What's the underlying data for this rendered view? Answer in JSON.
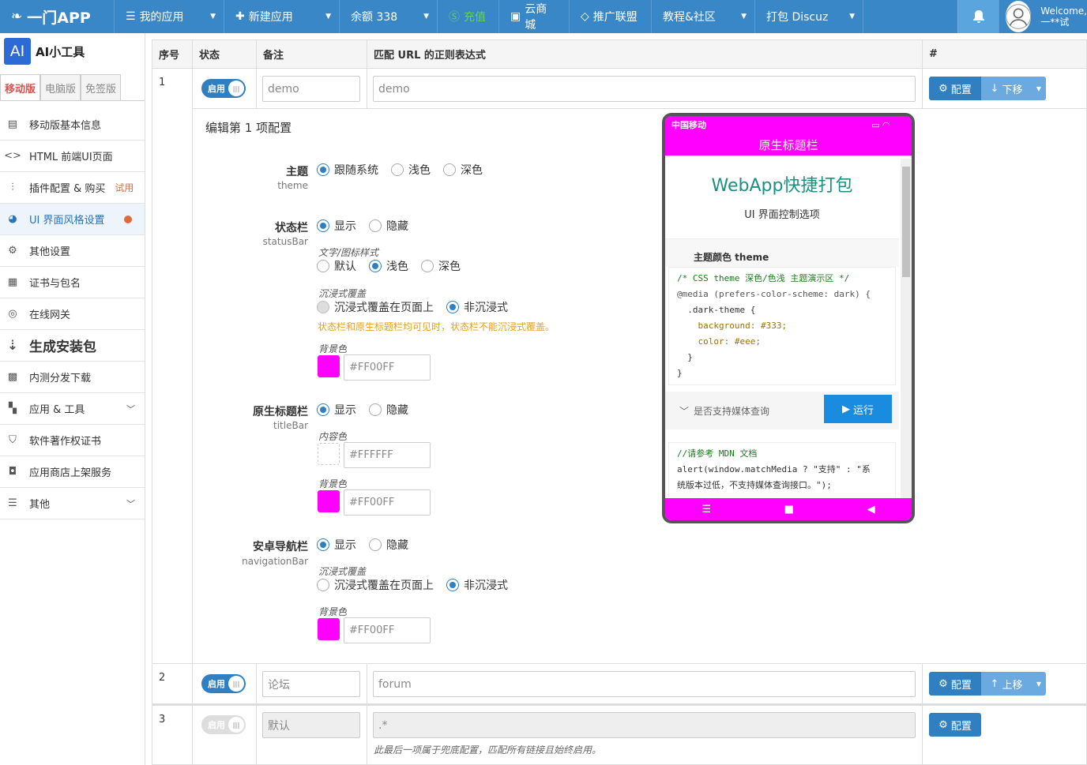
{
  "topbar": {
    "logo": "一门APP",
    "nav": [
      {
        "label": "我的应用",
        "icon": "≡",
        "dropdown": true
      },
      {
        "label": "新建应用",
        "icon": "+",
        "dropdown": true
      },
      {
        "label": "余额 338",
        "icon": "",
        "dropdown": true
      },
      {
        "label": "充值",
        "icon": "Ⓢ",
        "dropdown": false,
        "color": "#5fd35f"
      },
      {
        "label": "云商城",
        "icon": "▣",
        "dropdown": false
      },
      {
        "label": "推广联盟",
        "icon": "◇",
        "dropdown": false
      },
      {
        "label": "教程&社区",
        "icon": "",
        "dropdown": true
      },
      {
        "label": "打包 Discuz",
        "icon": "",
        "dropdown": true
      }
    ],
    "welcome_line1": "Welcome,",
    "welcome_line2": "一**试"
  },
  "sidebar": {
    "title": "AI小工具",
    "logo_text": "AI",
    "tabs": [
      "移动版",
      "电脑版",
      "免签版"
    ],
    "items": [
      {
        "label": "移动版基本信息",
        "icon": "document-icon"
      },
      {
        "label": "HTML 前端UI页面",
        "icon": "code-icon"
      },
      {
        "label": "插件配置 & 购买",
        "icon": "sliders-icon",
        "badge": "试用"
      },
      {
        "label": "UI 界面风格设置",
        "icon": "palette-icon",
        "active": true
      },
      {
        "label": "其他设置",
        "icon": "gear-icon"
      },
      {
        "label": "证书与包名",
        "icon": "certificate-icon"
      },
      {
        "label": "在线网关",
        "icon": "gateway-icon"
      },
      {
        "label": "生成安装包",
        "icon": "build-icon",
        "big": true
      },
      {
        "label": "内测分发下载",
        "icon": "qrcode-icon"
      },
      {
        "label": "应用 & 工具",
        "icon": "grid-icon",
        "chevron": true
      },
      {
        "label": "软件著作权证书",
        "icon": "copyright-icon"
      },
      {
        "label": "应用商店上架服务",
        "icon": "store-icon"
      },
      {
        "label": "其他",
        "icon": "menu-icon",
        "chevron": true
      }
    ]
  },
  "table": {
    "headers": [
      "序号",
      "状态",
      "备注",
      "匹配 URL 的正则表达式",
      "#"
    ],
    "rows": [
      {
        "index": "1",
        "toggle": "启用",
        "note": "demo",
        "regex": "demo",
        "config": "配置",
        "move": "下移"
      },
      {
        "index": "2",
        "toggle": "启用",
        "note": "论坛",
        "regex": "forum",
        "config": "配置",
        "move": "上移"
      },
      {
        "index": "3",
        "toggle": "启用",
        "note_placeholder": "默认",
        "regex": ".*",
        "config": "配置",
        "hint": "此最后一项属于兜底配置，匹配所有链接且始终启用。"
      }
    ]
  },
  "editor": {
    "title": "编辑第 1 项配置",
    "theme": {
      "label": "主题",
      "sub": "theme",
      "options": [
        "跟随系统",
        "浅色",
        "深色"
      ],
      "selected": 0
    },
    "statusbar": {
      "label": "状态栏",
      "sub": "statusBar",
      "options": [
        "显示",
        "隐藏"
      ],
      "selected": 0,
      "text_style_label": "文字/图标样式",
      "text_style_options": [
        "默认",
        "浅色",
        "深色"
      ],
      "text_style_selected": 1,
      "immersive_label": "沉浸式覆盖",
      "immersive_options": [
        "沉浸式覆盖在页面上",
        "非沉浸式"
      ],
      "immersive_selected": 1,
      "warning": "状态栏和原生标题栏均可见时，状态栏不能沉浸式覆盖。",
      "bg_label": "背景色",
      "bg_value": "#FF00FF"
    },
    "titlebar": {
      "label": "原生标题栏",
      "sub": "titleBar",
      "options": [
        "显示",
        "隐藏"
      ],
      "selected": 0,
      "content_label": "内容色",
      "content_value": "#FFFFFF",
      "bg_label": "背景色",
      "bg_value": "#FF00FF"
    },
    "navbar": {
      "label": "安卓导航栏",
      "sub": "navigationBar",
      "options": [
        "显示",
        "隐藏"
      ],
      "selected": 0,
      "immersive_label": "沉浸式覆盖",
      "immersive_options": [
        "沉浸式覆盖在页面上",
        "非沉浸式"
      ],
      "immersive_selected": 1,
      "bg_label": "背景色",
      "bg_value": "#FF00FF"
    }
  },
  "phone": {
    "carrier": "中国移动",
    "title": "原生标题栏",
    "heading": "WebApp快捷打包",
    "subheading": "UI 界面控制选项",
    "section": "主题颜色 theme",
    "code_lines": [
      "/* CSS theme 深色/色浅 主题演示区 */",
      "@media (prefers-color-scheme: dark) {",
      "  .dark-theme {",
      "    background: #333;",
      "    color: #eee;",
      "  }",
      "}"
    ],
    "collapse_label": "是否支持媒体查询",
    "run_label": "运行",
    "code2_lines": [
      "//请参考 MDN 文档",
      "alert(window.matchMedia ? \"支持\" : \"系",
      "统版本过低，不支持媒体查询接口。\");"
    ]
  },
  "colors": {
    "accent": "#2f7fc1",
    "magenta": "#FF00FF",
    "topbar": "#3a87c8"
  }
}
